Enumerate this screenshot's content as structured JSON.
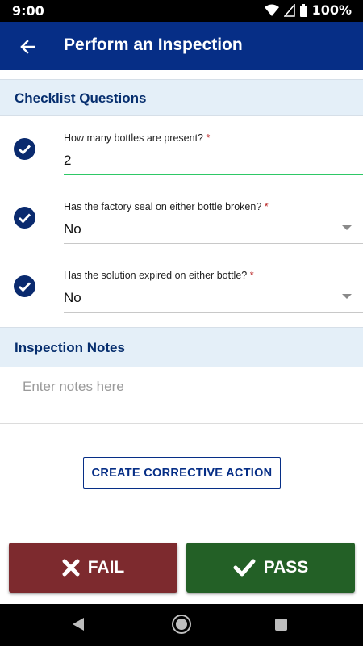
{
  "status_bar": {
    "time": "9:00",
    "battery": "100%"
  },
  "app_bar": {
    "title": "Perform an Inspection"
  },
  "checklist": {
    "header": "Checklist Questions",
    "questions": [
      {
        "label": "How many bottles are present?",
        "required": "*",
        "value": "2",
        "type": "text"
      },
      {
        "label": "Has the factory seal on either bottle broken?",
        "required": "*",
        "value": "No",
        "type": "select"
      },
      {
        "label": "Has the solution expired on either bottle?",
        "required": "*",
        "value": "No",
        "type": "select"
      }
    ]
  },
  "notes": {
    "header": "Inspection Notes",
    "placeholder": "Enter notes here"
  },
  "corrective_action": {
    "label": "CREATE CORRECTIVE ACTION"
  },
  "actions": {
    "fail_label": "FAIL",
    "pass_label": "PASS"
  },
  "colors": {
    "primary": "#062e86",
    "section_bg": "#e4eff8",
    "fail": "#7d2a2e",
    "pass": "#236026",
    "active_underline": "#2ec866"
  }
}
